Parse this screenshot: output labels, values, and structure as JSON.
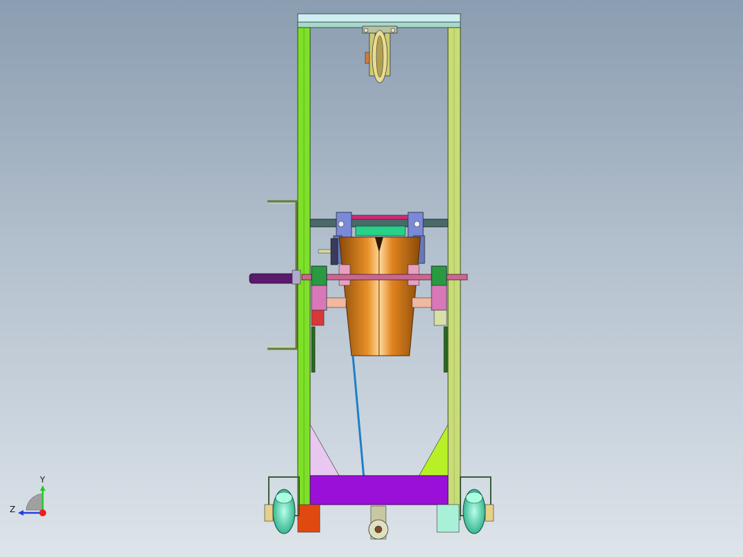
{
  "triad": {
    "y_label": "Y",
    "z_label": "Z"
  },
  "colors": {
    "background_top": "#8b9db1",
    "background_bottom": "#dde4ea",
    "frame_left": "#7ee028",
    "frame_right": "#c8dc78",
    "top_beam": "#cfeef0",
    "base_beam": "#9b10d8",
    "bucket": "#d4781a",
    "wheel": "#3ed8a8",
    "rope": "#1e7ec8",
    "handle": "#5a1a6e"
  }
}
